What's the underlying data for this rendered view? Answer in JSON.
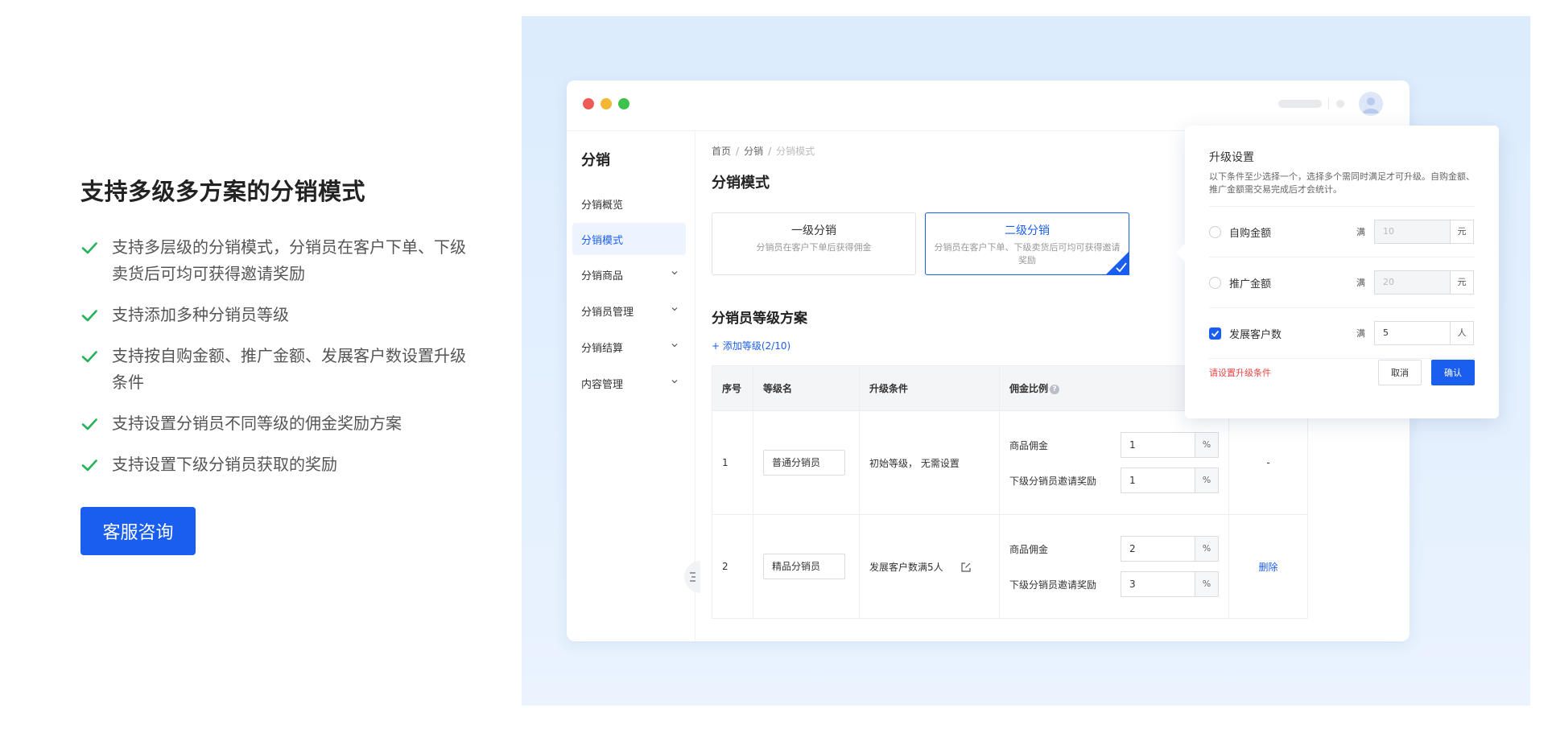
{
  "left": {
    "title": "支持多级多方案的分销模式",
    "features": [
      "支持多层级的分销模式，分销员在客户下单、下级卖货后可均可获得邀请奖励",
      "支持添加多种分销员等级",
      "支持按自购金额、推广金额、发展客户数设置升级条件",
      "支持设置分销员不同等级的佣金奖励方案",
      "支持设置下级分销员获取的奖励"
    ],
    "cta_label": "客服咨询"
  },
  "colors": {
    "accent": "#1a5ef0",
    "check": "#25b35a",
    "panel_bg": "#dcecfd",
    "warning": "#e64545"
  },
  "sidebar": {
    "title": "分销",
    "items": [
      {
        "label": "分销概览",
        "expandable": false,
        "active": false
      },
      {
        "label": "分销模式",
        "expandable": false,
        "active": true
      },
      {
        "label": "分销商品",
        "expandable": true,
        "active": false
      },
      {
        "label": "分销员管理",
        "expandable": true,
        "active": false
      },
      {
        "label": "分销结算",
        "expandable": true,
        "active": false
      },
      {
        "label": "内容管理",
        "expandable": true,
        "active": false
      }
    ]
  },
  "breadcrumb": {
    "home": "首页",
    "section": "分销",
    "current": "分销模式"
  },
  "main": {
    "title": "分销模式",
    "modes": [
      {
        "title": "一级分销",
        "desc": "分销员在客户下单后获得佣金",
        "selected": false
      },
      {
        "title": "二级分销",
        "desc": "分销员在客户下单、下级卖货后可均可获得邀请奖励",
        "selected": true
      }
    ],
    "level_title": "分销员等级方案",
    "add_level": "+ 添加等级(2/10)"
  },
  "table": {
    "headers": [
      "序号",
      "等级名",
      "升级条件",
      "佣金比例"
    ],
    "rows": [
      {
        "index": "1",
        "name": "普通分销员",
        "condition": "初始等级， 无需设置",
        "commission_label": "商品佣金",
        "commission_value": "1",
        "invite_label": "下级分销员邀请奖励",
        "invite_value": "1",
        "unit": "%",
        "action": "-"
      },
      {
        "index": "2",
        "name": "精品分销员",
        "condition": "发展客户数满5人",
        "commission_label": "商品佣金",
        "commission_value": "2",
        "invite_label": "下级分销员邀请奖励",
        "invite_value": "3",
        "unit": "%",
        "action": "删除"
      }
    ]
  },
  "popover": {
    "title": "升级设置",
    "desc": "以下条件至少选择一个，选择多个需同时满足才可升级。自购金额、推广金额需交易完成后才会统计。",
    "rows": [
      {
        "label": "自购金额",
        "prefix": "满",
        "value": "10",
        "unit": "元",
        "checked": false
      },
      {
        "label": "推广金额",
        "prefix": "满",
        "value": "20",
        "unit": "元",
        "checked": false
      },
      {
        "label": "发展客户数",
        "prefix": "满",
        "value": "5",
        "unit": "人",
        "checked": true
      }
    ],
    "warning": "请设置升级条件",
    "cancel": "取消",
    "confirm": "确认"
  }
}
